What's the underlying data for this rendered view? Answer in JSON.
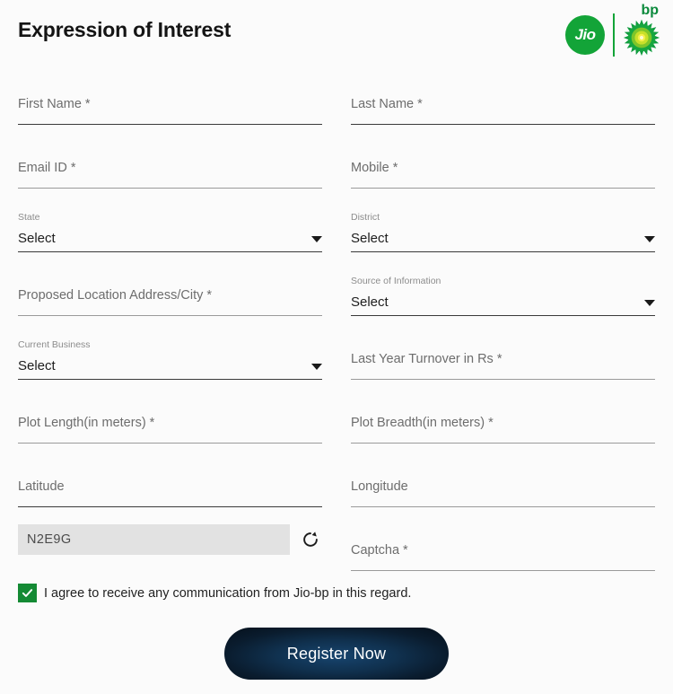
{
  "header": {
    "title": "Expression of Interest",
    "logos": {
      "jio_label": "Jio",
      "bp_label": "bp"
    }
  },
  "form": {
    "rows": [
      {
        "left": {
          "kind": "text",
          "label": "First Name *",
          "value": ""
        },
        "right": {
          "kind": "text",
          "label": "Last Name *",
          "value": ""
        }
      },
      {
        "left": {
          "kind": "text",
          "label": "Email ID *",
          "value": ""
        },
        "right": {
          "kind": "text",
          "label": "Mobile *",
          "value": ""
        }
      },
      {
        "left": {
          "kind": "select",
          "caption": "State",
          "value": "Select"
        },
        "right": {
          "kind": "select",
          "caption": "District",
          "value": "Select"
        }
      },
      {
        "left": {
          "kind": "text",
          "label": "Proposed Location Address/City *",
          "value": ""
        },
        "right": {
          "kind": "select",
          "caption": "Source of Information",
          "value": "Select"
        }
      },
      {
        "left": {
          "kind": "select",
          "caption": "Current Business",
          "value": "Select"
        },
        "right": {
          "kind": "text",
          "label": "Last Year Turnover in Rs *",
          "value": ""
        }
      },
      {
        "left": {
          "kind": "text",
          "label": "Plot Length(in meters) *",
          "value": ""
        },
        "right": {
          "kind": "text",
          "label": "Plot Breadth(in meters) *",
          "value": ""
        }
      },
      {
        "left": {
          "kind": "text",
          "label": "Latitude",
          "value": ""
        },
        "right": {
          "kind": "text",
          "label": "Longitude",
          "value": ""
        }
      }
    ],
    "captcha": {
      "code": "N2E9G",
      "refresh_icon": "refresh-icon",
      "input_label": "Captcha *",
      "input_value": ""
    },
    "consent": {
      "checked": true,
      "checkmark": "✓",
      "text": "I agree to receive any communication from Jio-bp in this regard."
    },
    "submit_label": "Register Now"
  },
  "colors": {
    "jio_green": "#13a438",
    "bp_green": "#0b8a3c",
    "checkbox_green": "#148a34",
    "button_navy": "#10314f",
    "page_background": "#fbfbfb"
  }
}
